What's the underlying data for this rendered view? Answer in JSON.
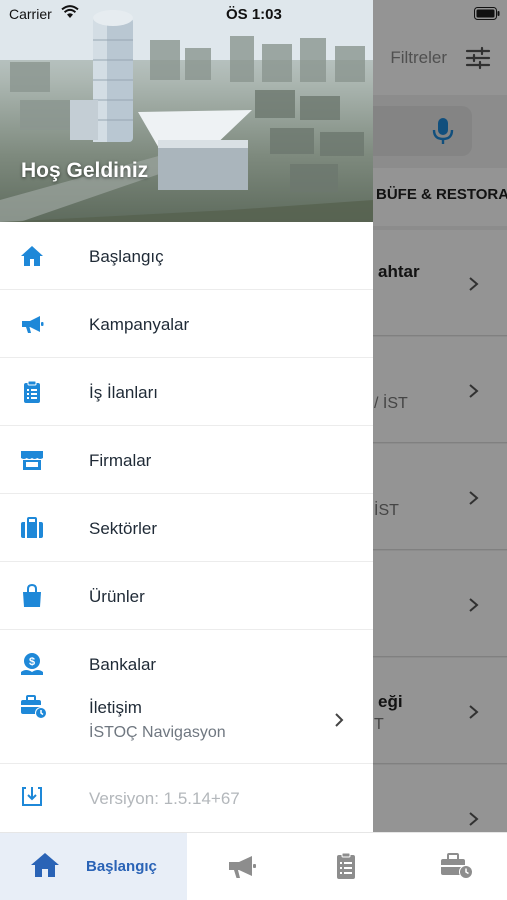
{
  "status_bar": {
    "carrier": "Carrier",
    "time": "ÖS 1:03"
  },
  "background": {
    "filter_label": "Filtreler",
    "category_label": "BÜFE & RESTORA",
    "rows": [
      {
        "title": "ahtar",
        "subtitle": ""
      },
      {
        "title": "",
        "subtitle": "/ İST"
      },
      {
        "title": "",
        "subtitle": "İST"
      },
      {
        "title": "",
        "subtitle": ""
      },
      {
        "title": "eği",
        "subtitle": "T"
      },
      {
        "title": "",
        "subtitle": ""
      }
    ]
  },
  "drawer": {
    "welcome": "Hoş Geldiniz",
    "items": [
      {
        "label": "Başlangıç",
        "icon": "home-icon"
      },
      {
        "label": "Kampanyalar",
        "icon": "megaphone-icon"
      },
      {
        "label": "İş İlanları",
        "icon": "clipboard-list-icon"
      },
      {
        "label": "Firmalar",
        "icon": "store-icon"
      },
      {
        "label": "Sektörler",
        "icon": "suitcase-icon"
      },
      {
        "label": "Ürünler",
        "icon": "shopping-bag-icon"
      },
      {
        "label": "Bankalar",
        "icon": "money-hand-icon"
      }
    ],
    "contact": {
      "label": "İletişim",
      "sublabel": "İSTOÇ Navigasyon",
      "icon": "briefcase-clock-icon"
    },
    "version": {
      "label": "Versiyon: 1.5.14+67",
      "icon": "download-box-icon"
    }
  },
  "tabbar": {
    "active_label": "Başlangıç",
    "tabs": [
      "home-icon",
      "megaphone-icon",
      "clipboard-list-icon",
      "briefcase-clock-icon"
    ]
  },
  "colors": {
    "accent": "#1e88d8",
    "tab_active": "#2a63b6",
    "tab_inactive": "#8d8d8d"
  }
}
